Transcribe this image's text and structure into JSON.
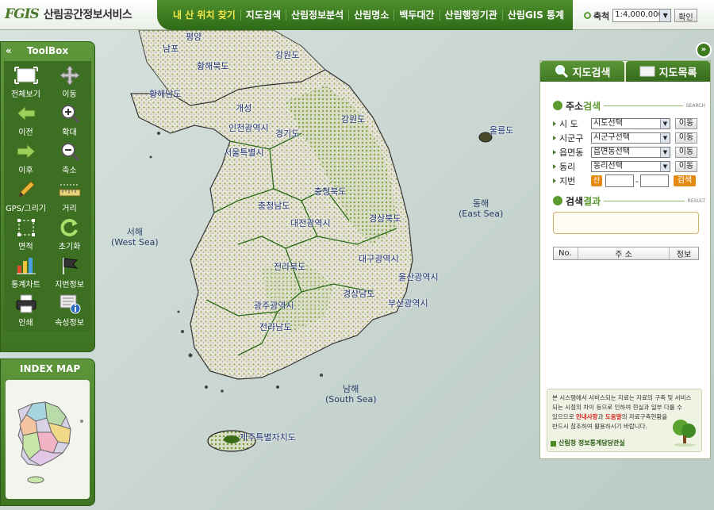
{
  "header": {
    "logo_mark": "FGIS",
    "logo_text": "산림공간정보서비스",
    "nav": [
      "내 산 위치 찾기",
      "지도검색",
      "산림정보분석",
      "산림명소",
      "백두대간",
      "산림행정기관",
      "산림GIS 통계"
    ],
    "scale_label": "축척",
    "scale_value": "1:4,000,000",
    "confirm_label": "확인"
  },
  "toolbox": {
    "collapse_symbol": "«",
    "title": "ToolBox",
    "tools": [
      {
        "label": "전체보기",
        "icon": "full-extent-icon"
      },
      {
        "label": "이동",
        "icon": "pan-icon"
      },
      {
        "label": "이전",
        "icon": "back-arrow-icon"
      },
      {
        "label": "확대",
        "icon": "zoom-in-icon"
      },
      {
        "label": "이후",
        "icon": "forward-arrow-icon"
      },
      {
        "label": "축소",
        "icon": "zoom-out-icon"
      },
      {
        "label": "GPS/그리기",
        "icon": "pencil-icon"
      },
      {
        "label": "거리",
        "icon": "ruler-icon"
      },
      {
        "label": "면적",
        "icon": "area-icon"
      },
      {
        "label": "초기화",
        "icon": "refresh-icon"
      },
      {
        "label": "통계차트",
        "icon": "bar-chart-icon"
      },
      {
        "label": "지번정보",
        "icon": "flag-icon"
      },
      {
        "label": "인쇄",
        "icon": "printer-icon"
      },
      {
        "label": "속성정보",
        "icon": "info-icon"
      }
    ]
  },
  "index_map": {
    "title": "INDEX MAP"
  },
  "map": {
    "seas": [
      {
        "name": "서해",
        "eng": "(West Sea)"
      },
      {
        "name": "동해",
        "eng": "(East Sea)"
      },
      {
        "name": "남해",
        "eng": "(South Sea)"
      }
    ],
    "places": [
      "평양",
      "남포",
      "황해북도",
      "강원도",
      "황해남도",
      "개성",
      "인천광역시",
      "경기도",
      "서울특별시",
      "강원도",
      "울릉도",
      "충청북도",
      "충청남도",
      "대전광역시",
      "경상북도",
      "전라북도",
      "대구광역시",
      "울산광역시",
      "광주광역시",
      "경상남도",
      "부산광역시",
      "전라남도",
      "제주특별자치도"
    ]
  },
  "panel": {
    "expand_symbol": "»",
    "tabs": [
      "지도검색",
      "지도목록"
    ],
    "address_search": {
      "title_a": "주소",
      "title_b": "검색",
      "eng": "SEARCH"
    },
    "fields": [
      {
        "label": "시 도",
        "value": "시도선택",
        "button": "이동"
      },
      {
        "label": "시군구",
        "value": "시군구선택",
        "button": "이동"
      },
      {
        "label": "읍면동",
        "value": "읍면동선택",
        "button": "이동"
      },
      {
        "label": "동리",
        "value": "동리선택",
        "button": "이동"
      }
    ],
    "jibun": {
      "label": "지번",
      "badge": "산",
      "search": "검색"
    },
    "result": {
      "title_a": "검색",
      "title_b": "결과",
      "eng": "RESULT"
    },
    "table_head": [
      "No.",
      "주 소",
      "정보"
    ],
    "notice": {
      "line1": "본 시스템에서 서비스되는 자료는 자료의 구축 및 서비스",
      "line2": "되는 시점의 차이 등으로 인하여 현실과 일부 다를 수",
      "line3a": "있으므로 ",
      "hl1": "안내사항",
      "line3b": "과 ",
      "hl2": "도움말",
      "line3c": "의 자료구축현황을",
      "line4": "반드시 참조하여 활용하시기 바랍니다.",
      "link": "산림청 정보통계담당관실"
    }
  }
}
